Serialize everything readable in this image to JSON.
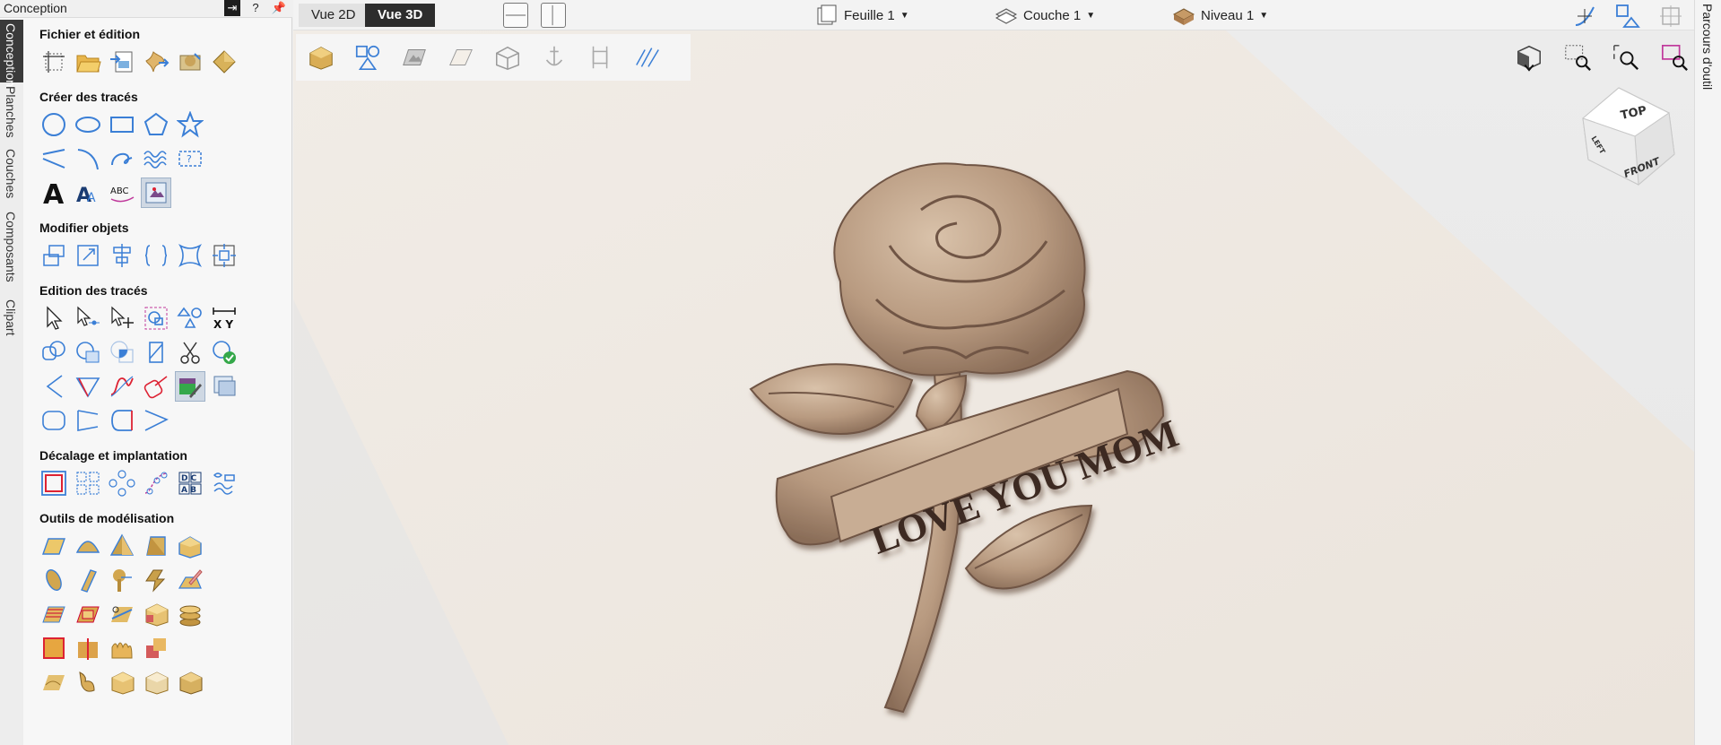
{
  "panel": {
    "title": "Conception",
    "help_label": "?",
    "pin_label": "⮏"
  },
  "left_tabs": [
    "Conception",
    "Planches",
    "Couches",
    "Composants",
    "Clipart"
  ],
  "sections": {
    "file": "Fichier et édition",
    "vectors": "Créer des tracés",
    "modify": "Modifier objets",
    "edit": "Edition des tracés",
    "offset": "Décalage et implantation",
    "modeling": "Outils de modélisation"
  },
  "text_icons": {
    "big_a": "A",
    "abc": "ABC",
    "xy": "X   Y",
    "dc": "D C",
    "ab": "A B"
  },
  "toolbar": {
    "view2d": "Vue 2D",
    "view3d": "Vue 3D",
    "sheet": "Feuille 1",
    "layer": "Couche 1",
    "level": "Niveau 1"
  },
  "right_tab": "Parcours d'outil",
  "model_text": "LOVE YOU MOM",
  "viewcube": {
    "top": "TOP",
    "front": "FRONT",
    "left": "LEFT"
  },
  "colors": {
    "accent_blue": "#3b7fd6",
    "model_bronze": "#b89a80",
    "active_tab": "#2d2d2d"
  }
}
